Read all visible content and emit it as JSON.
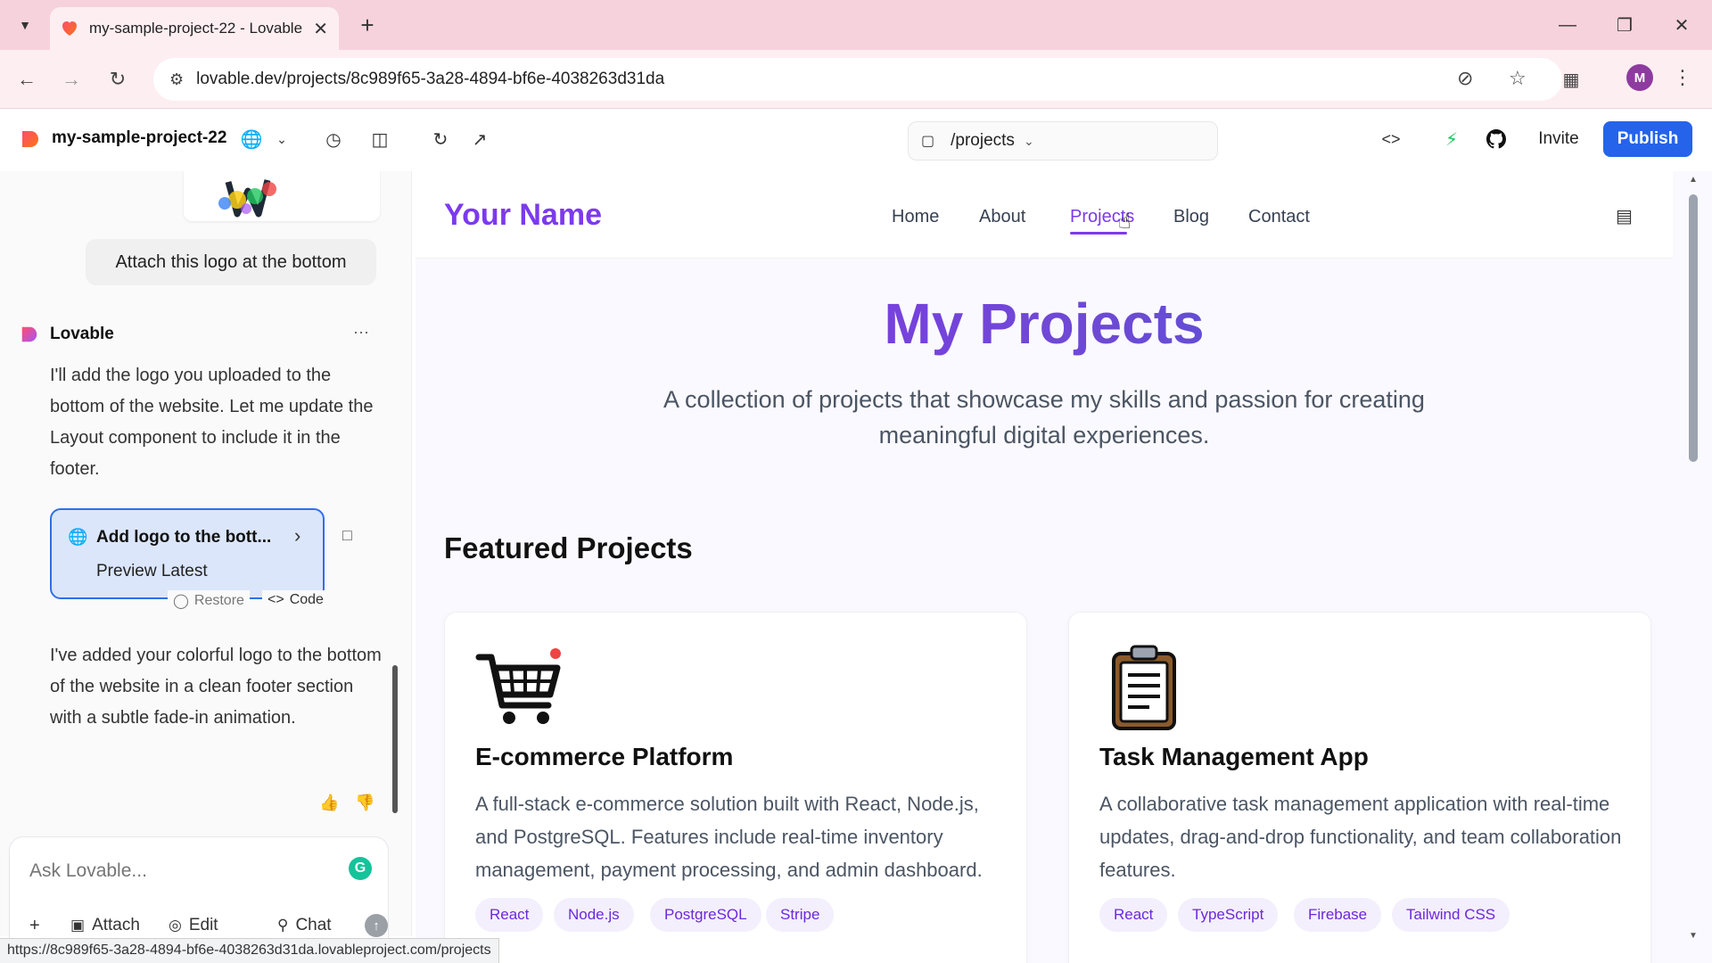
{
  "browser": {
    "tab_title": "my-sample-project-22 - Lovable",
    "url": "lovable.dev/projects/8c989f65-3a28-4894-bf6e-4038263d31da",
    "status_url": "https://8c989f65-3a28-4894-bf6e-4038263d31da.lovableproject.com/projects",
    "profile_initial": "M"
  },
  "toolbar": {
    "project_name": "my-sample-project-22",
    "route": "/projects",
    "invite_label": "Invite",
    "publish_label": "Publish",
    "accent_color": "#2563eb"
  },
  "chat": {
    "user_message": "Attach this logo at the bottom",
    "bot_name": "Lovable",
    "bot_reply_1": "I'll add the logo you uploaded to the bottom of the website. Let me update the Layout component to include it in the footer.",
    "change_card": {
      "title": "Add logo to the bott...",
      "subtitle": "Preview Latest",
      "restore_label": "Restore",
      "code_label": "Code"
    },
    "bot_reply_2": "I've added your colorful logo to the bottom of the website in a clean footer section with a subtle fade-in animation.",
    "composer_placeholder": "Ask Lovable...",
    "attach_label": "Attach",
    "edit_label": "Edit",
    "chat_label": "Chat"
  },
  "site": {
    "brand": "Your Name",
    "nav": [
      "Home",
      "About",
      "Projects",
      "Blog",
      "Contact"
    ],
    "active_nav": "Projects",
    "hero_title": "My Projects",
    "hero_subtitle": "A collection of projects that showcase my skills and passion for creating meaningful digital experiences.",
    "featured_heading": "Featured Projects",
    "brand_color": "#7c3aed",
    "projects": [
      {
        "icon": "shopping-cart-icon",
        "title": "E-commerce Platform",
        "description": "A full-stack e-commerce solution built with React, Node.js, and PostgreSQL. Features include real-time inventory management, payment processing, and admin dashboard.",
        "tags": [
          "React",
          "Node.js",
          "PostgreSQL",
          "Stripe"
        ]
      },
      {
        "icon": "clipboard-icon",
        "title": "Task Management App",
        "description": "A collaborative task management application with real-time updates, drag-and-drop functionality, and team collaboration features.",
        "tags": [
          "React",
          "TypeScript",
          "Firebase",
          "Tailwind CSS"
        ]
      }
    ]
  }
}
